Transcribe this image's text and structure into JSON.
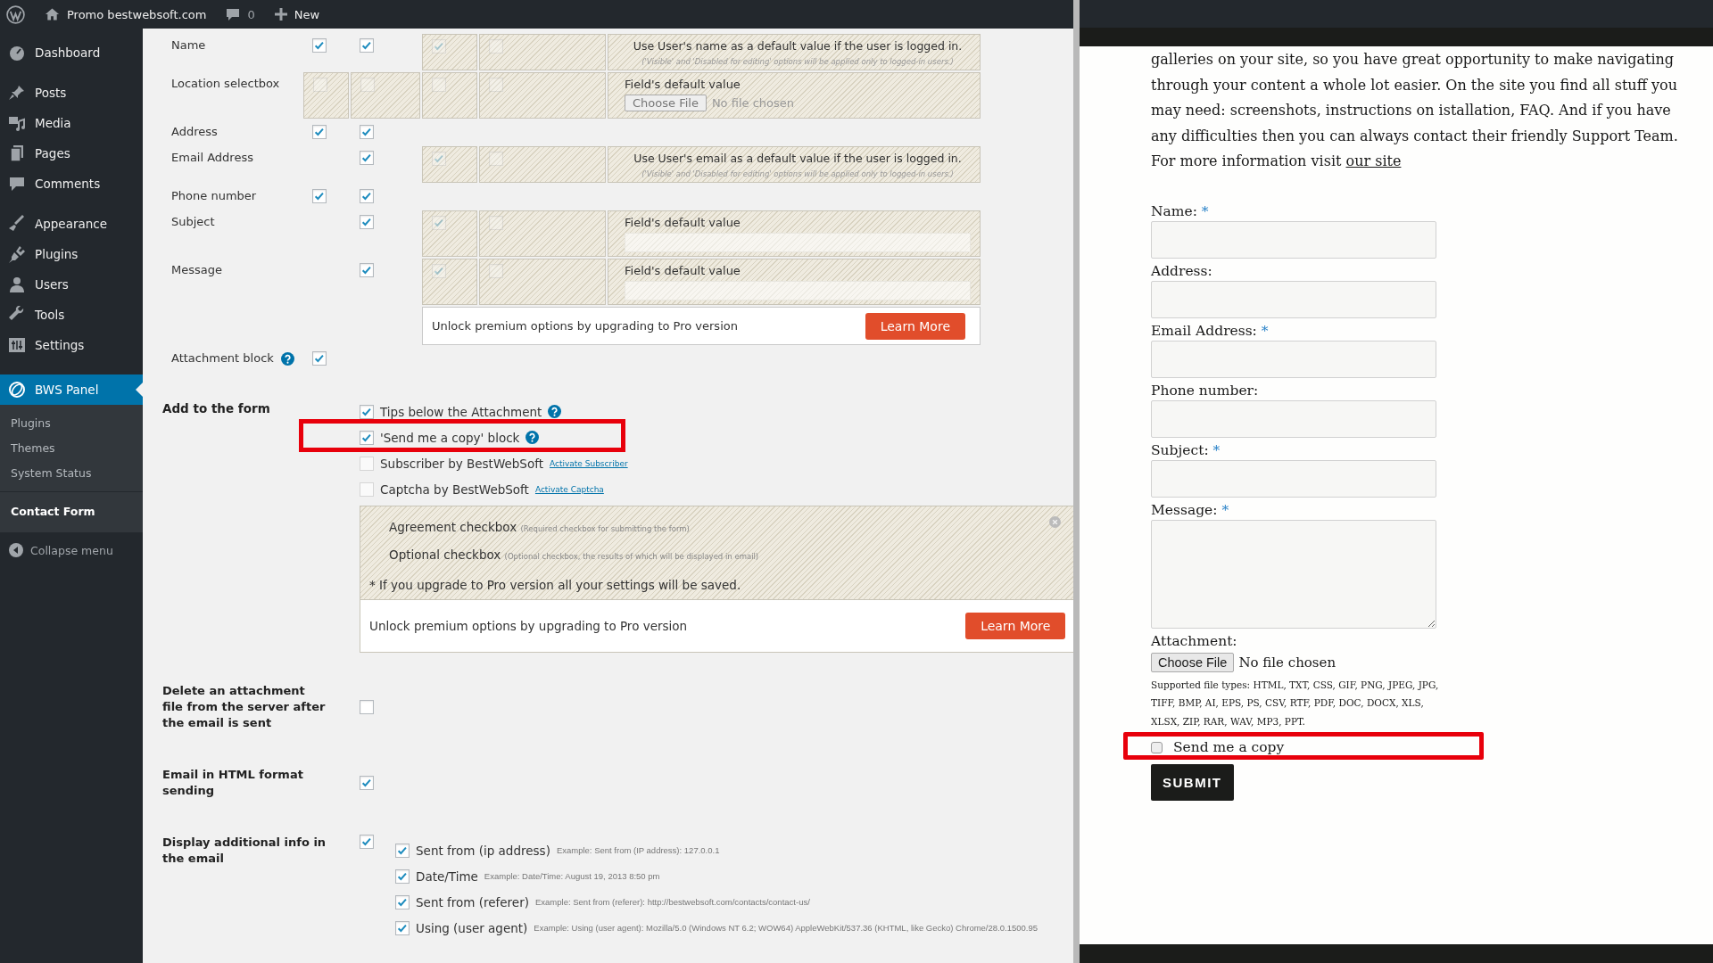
{
  "admin_bar": {
    "site": "Promo bestwebsoft.com",
    "comments": "0",
    "new": "New"
  },
  "sidebar": {
    "items": [
      {
        "label": "Dashboard",
        "selected": false
      },
      {
        "label": "Posts",
        "selected": false
      },
      {
        "label": "Media",
        "selected": false
      },
      {
        "label": "Pages",
        "selected": false
      },
      {
        "label": "Comments",
        "selected": false
      },
      {
        "label": "Appearance",
        "selected": false
      },
      {
        "label": "Plugins",
        "selected": false
      },
      {
        "label": "Users",
        "selected": false
      },
      {
        "label": "Tools",
        "selected": false
      },
      {
        "label": "Settings",
        "selected": false
      },
      {
        "label": "BWS Panel",
        "selected": true
      }
    ],
    "submenu": [
      {
        "label": "Plugins",
        "selected": false
      },
      {
        "label": "Themes",
        "selected": false
      },
      {
        "label": "System Status",
        "selected": false
      },
      {
        "label": "Contact Form",
        "selected": true
      }
    ],
    "collapse": "Collapse menu"
  },
  "fields_table": {
    "rows": [
      {
        "kind": "field",
        "label": "Name",
        "help": false,
        "column_1": {
          "kind": "checkbox",
          "checked": true
        },
        "column_2": {
          "kind": "checkbox",
          "checked": true
        },
        "column_3": {
          "kind": "locked",
          "checked": true
        },
        "column_4": {
          "kind": "locked",
          "checked": false
        },
        "column_5": {
          "kind": "note",
          "text": "Use User's name as a default value if the user is logged in.",
          "hint": "('Visible' and 'Disabled for editing' options will be applied only to logged-in users.)"
        }
      },
      {
        "kind": "field",
        "label": "Location selectbox",
        "help": false,
        "column_1": {
          "kind": "locked",
          "checked": false
        },
        "column_2": {
          "kind": "locked",
          "checked": false
        },
        "column_3": {
          "kind": "locked",
          "checked": false
        },
        "column_4": {
          "kind": "locked",
          "checked": false
        },
        "column_5": {
          "kind": "default_file",
          "label": "Field's default value",
          "button": "Choose File",
          "status": "No file chosen"
        }
      },
      {
        "kind": "field",
        "label": "Address",
        "help": false,
        "column_1": {
          "kind": "checkbox",
          "checked": true
        },
        "column_2": {
          "kind": "checkbox",
          "checked": true
        },
        "column_3": {
          "kind": "blank"
        },
        "column_4": {
          "kind": "blank"
        },
        "column_5": {
          "kind": "blank"
        }
      },
      {
        "kind": "field",
        "label": "Email Address",
        "help": false,
        "column_1": {
          "kind": "blank"
        },
        "column_2": {
          "kind": "checkbox",
          "checked": true
        },
        "column_3": {
          "kind": "locked",
          "checked": true
        },
        "column_4": {
          "kind": "locked",
          "checked": false
        },
        "column_5": {
          "kind": "note",
          "text": "Use User's email as a default value if the user is logged in.",
          "hint": "('Visible' and 'Disabled for editing' options will be applied only to logged-in users.)"
        }
      },
      {
        "kind": "field",
        "label": "Phone number",
        "help": false,
        "column_1": {
          "kind": "checkbox",
          "checked": true
        },
        "column_2": {
          "kind": "checkbox",
          "checked": true
        },
        "column_3": {
          "kind": "blank"
        },
        "column_4": {
          "kind": "blank"
        },
        "column_5": {
          "kind": "blank"
        }
      },
      {
        "kind": "field",
        "label": "Subject",
        "help": false,
        "column_1": {
          "kind": "blank"
        },
        "column_2": {
          "kind": "checkbox",
          "checked": true
        },
        "column_3": {
          "kind": "locked",
          "checked": true
        },
        "column_4": {
          "kind": "locked",
          "checked": false
        },
        "column_5": {
          "kind": "default_text",
          "label": "Field's default value"
        }
      },
      {
        "kind": "field",
        "label": "Message",
        "help": false,
        "column_1": {
          "kind": "blank"
        },
        "column_2": {
          "kind": "checkbox",
          "checked": true
        },
        "column_3": {
          "kind": "locked",
          "checked": true
        },
        "column_4": {
          "kind": "locked",
          "checked": false
        },
        "column_5": {
          "kind": "default_text",
          "label": "Field's default value"
        }
      },
      {
        "kind": "upgrade",
        "text": "Unlock premium options by upgrading to Pro version",
        "button": "Learn More"
      },
      {
        "kind": "field",
        "label": "Attachment block",
        "help": true,
        "column_1": {
          "kind": "checkbox",
          "checked": true
        },
        "column_2": {
          "kind": "blank"
        },
        "column_3": {
          "kind": "blank"
        },
        "column_4": {
          "kind": "blank"
        },
        "column_5": {
          "kind": "blank"
        }
      }
    ]
  },
  "add_to_form": {
    "label": "Add to the form",
    "items": [
      {
        "label": "Tips below the Attachment",
        "checked": true,
        "disabled": false,
        "help": true,
        "highlighted": false
      },
      {
        "label": "'Send me a copy' block",
        "checked": true,
        "disabled": false,
        "help": true,
        "highlighted": true
      },
      {
        "label": "Subscriber by BestWebSoft",
        "checked": false,
        "disabled": true,
        "help": false,
        "highlighted": false,
        "link": "Activate Subscriber"
      },
      {
        "label": "Captcha by BestWebSoft",
        "checked": false,
        "disabled": true,
        "help": false,
        "highlighted": false,
        "link": "Activate Captcha"
      }
    ],
    "pro_box": {
      "items": [
        {
          "label": "Agreement checkbox",
          "hint": "(Required checkbox for submitting the form)"
        },
        {
          "label": "Optional checkbox",
          "hint": "(Optional checkbox, the results of which will be displayed in email)"
        }
      ],
      "note": "* If you upgrade to Pro version all your settings will be saved.",
      "upgrade": {
        "text": "Unlock premium options by upgrading to Pro version",
        "button": "Learn More"
      }
    }
  },
  "settings": [
    {
      "label": "Delete an attachment file from the server after the email is sent",
      "checked": false
    },
    {
      "label": "Email in HTML format sending",
      "checked": true
    },
    {
      "label": "Display additional info in the email",
      "checked": true,
      "options": [
        {
          "label": "Sent from (ip address)",
          "example": "Example: Sent from (IP address): 127.0.0.1",
          "checked": true
        },
        {
          "label": "Date/Time",
          "example": "Example: Date/Time: August 19, 2013 8:50 pm",
          "checked": true
        },
        {
          "label": "Sent from (referer)",
          "example": "Example: Sent from (referer): http://bestwebsoft.com/contacts/contact-us/",
          "checked": true
        },
        {
          "label": "Using (user agent)",
          "example": "Example: Using (user agent): Mozilla/5.0 (Windows NT 6.2; WOW64) AppleWebKit/537.36 (KHTML, like Gecko) Chrome/28.0.1500.95",
          "checked": true
        }
      ]
    }
  ],
  "site": {
    "paragraph": "galleries on your site, so you have great opportunity to make navigating through your content a whole lot easier. On the site you find all stuff you may need: screenshots, instructions on istallation, FAQ. And if you have any difficulties then you can always contact their friendly Support Team. For more information visit ",
    "link": "our site",
    "fields": [
      {
        "kind": "text",
        "label": "Name:",
        "required": "*"
      },
      {
        "kind": "text",
        "label": "Address:"
      },
      {
        "kind": "text",
        "label": "Email Address:",
        "required": "*"
      },
      {
        "kind": "text",
        "label": "Phone number:"
      },
      {
        "kind": "text",
        "label": "Subject:",
        "required": "*"
      },
      {
        "kind": "textarea",
        "label": "Message:",
        "required": "*"
      }
    ],
    "attachment": {
      "label": "Attachment:",
      "button": "Choose File",
      "status": "No file chosen",
      "note": "Supported file types: HTML, TXT, CSS, GIF, PNG, JPEG, JPG, TIFF, BMP, AI, EPS, PS, CSV, RTF, PDF, DOC, DOCX, XLS, XLSX, ZIP, RAR, WAV, MP3, PPT."
    },
    "copy": {
      "label": "Send me a copy",
      "checked": false,
      "highlighted": true
    },
    "submit": "SUBMIT"
  }
}
